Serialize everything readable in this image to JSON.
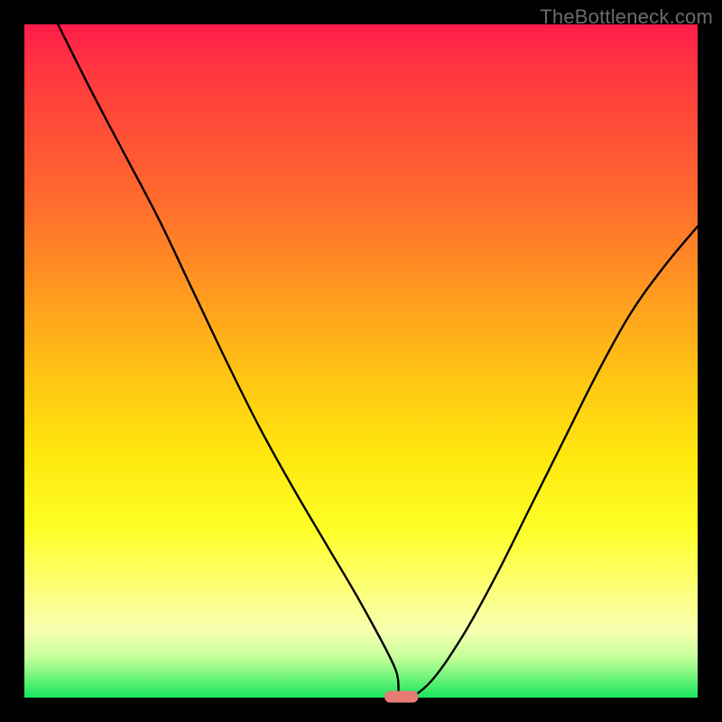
{
  "watermark_text": "TheBottleneck.com",
  "chart_data": {
    "type": "line",
    "title": "",
    "xlabel": "",
    "ylabel": "",
    "xlim": [
      0,
      100
    ],
    "ylim": [
      0,
      100
    ],
    "grid": false,
    "legend": false,
    "series": [
      {
        "name": "bottleneck-curve",
        "x": [
          5,
          10,
          15,
          20,
          25,
          30,
          35,
          40,
          45,
          50,
          55,
          56,
          60,
          65,
          70,
          75,
          80,
          85,
          90,
          95,
          100
        ],
        "values": [
          100,
          90,
          80.5,
          71,
          60.5,
          50,
          40,
          31,
          22.5,
          14,
          4.5,
          0,
          2,
          9,
          18,
          28,
          38,
          48,
          57,
          64,
          70
        ]
      }
    ],
    "marker": {
      "name": "optimal-point",
      "x_center": 56,
      "y": 0,
      "width_pct": 5,
      "color": "#e67a74"
    },
    "gradient_colors": {
      "top": "#ff1d4a",
      "mid": "#ffe70e",
      "bottom": "#16e45c"
    }
  }
}
